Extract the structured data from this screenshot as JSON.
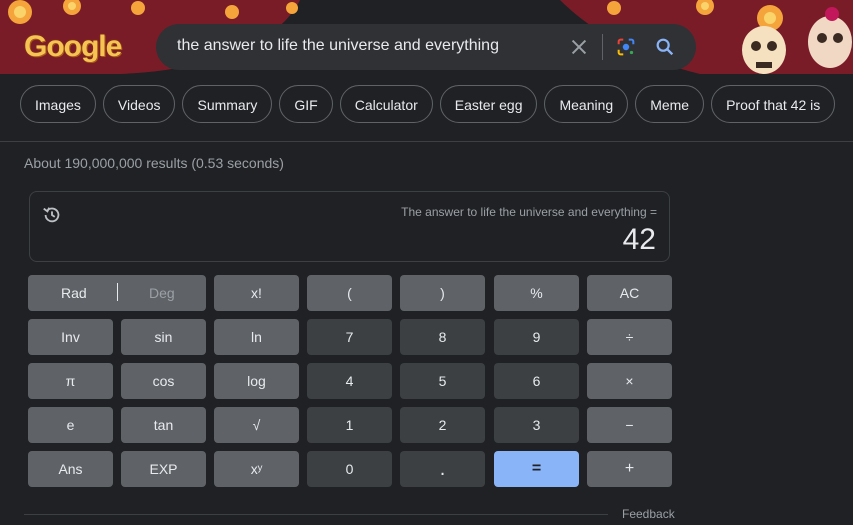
{
  "header": {
    "logo_text": "Google",
    "search_query": "the answer to life the universe and everything",
    "icons": [
      "close-icon",
      "google-lens-icon",
      "search-icon"
    ]
  },
  "chips": [
    "Images",
    "Videos",
    "Summary",
    "GIF",
    "Calculator",
    "Easter egg",
    "Meaning",
    "Meme",
    "Proof that 42 is"
  ],
  "results_stats": "About 190,000,000 results (0.53 seconds)",
  "calculator": {
    "expression": "The answer to life the universe and everything =",
    "result": "42",
    "keys": {
      "rad": "Rad",
      "deg": "Deg",
      "fact": "x!",
      "lparen": "(",
      "rparen": ")",
      "percent": "%",
      "ac": "AC",
      "inv": "Inv",
      "sin": "sin",
      "ln": "ln",
      "n7": "7",
      "n8": "8",
      "n9": "9",
      "divide": "÷",
      "pi": "π",
      "cos": "cos",
      "log": "log",
      "n4": "4",
      "n5": "5",
      "n6": "6",
      "multiply": "×",
      "e": "e",
      "tan": "tan",
      "sqrt": "√",
      "n1": "1",
      "n2": "2",
      "n3": "3",
      "minus": "−",
      "ans": "Ans",
      "exp": "EXP",
      "pow": "xʸ",
      "n0": "0",
      "dot": ".",
      "equals": "=",
      "plus": "+"
    }
  },
  "footer": {
    "feedback": "Feedback"
  },
  "colors": {
    "background": "#202124",
    "banner": "#7a1c28",
    "key_light": "#5f6368",
    "key_dark": "#3c4043",
    "equals_blue": "#8ab4f8"
  }
}
